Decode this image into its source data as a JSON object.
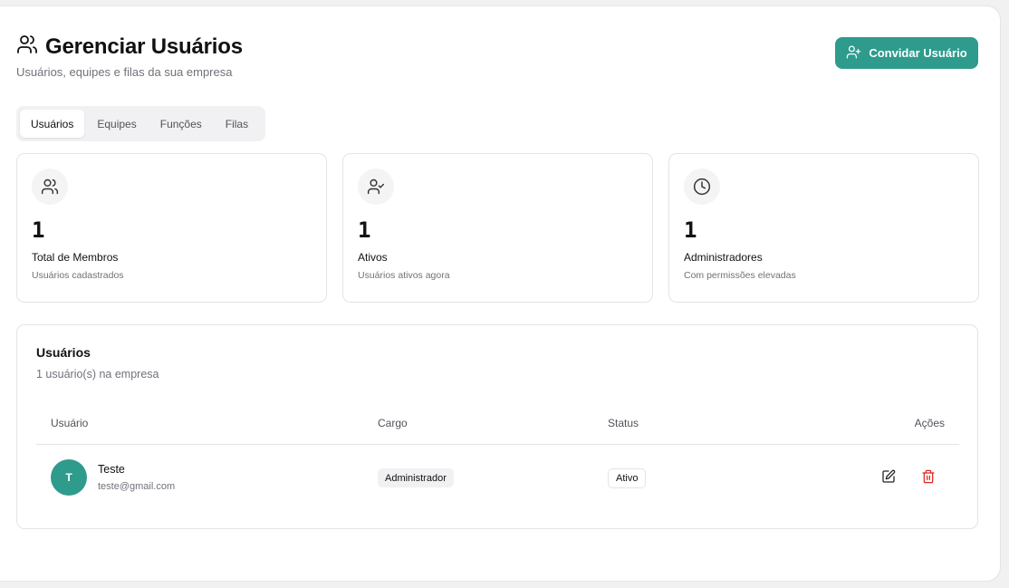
{
  "header": {
    "title": "Gerenciar Usuários",
    "subtitle": "Usuários, equipes e filas da sua empresa",
    "invite_label": "Convidar Usuário"
  },
  "tabs": [
    {
      "label": "Usuários",
      "active": true
    },
    {
      "label": "Equipes",
      "active": false
    },
    {
      "label": "Funções",
      "active": false
    },
    {
      "label": "Filas",
      "active": false
    }
  ],
  "stats": [
    {
      "icon": "users-icon",
      "value": "1",
      "label": "Total de Membros",
      "description": "Usuários cadastrados"
    },
    {
      "icon": "user-check-icon",
      "value": "1",
      "label": "Ativos",
      "description": "Usuários ativos agora"
    },
    {
      "icon": "clock-icon",
      "value": "1",
      "label": "Administradores",
      "description": "Com permissões elevadas"
    }
  ],
  "users_table": {
    "title": "Usuários",
    "count_text": "1 usuário(s) na empresa",
    "columns": [
      "Usuário",
      "Cargo",
      "Status",
      "Ações"
    ],
    "rows": [
      {
        "initial": "T",
        "name": "Teste",
        "email": "teste@gmail.com",
        "role": "Administrador",
        "status": "Ativo"
      }
    ]
  },
  "colors": {
    "accent": "#2e9b8d",
    "danger": "#dc2626"
  }
}
